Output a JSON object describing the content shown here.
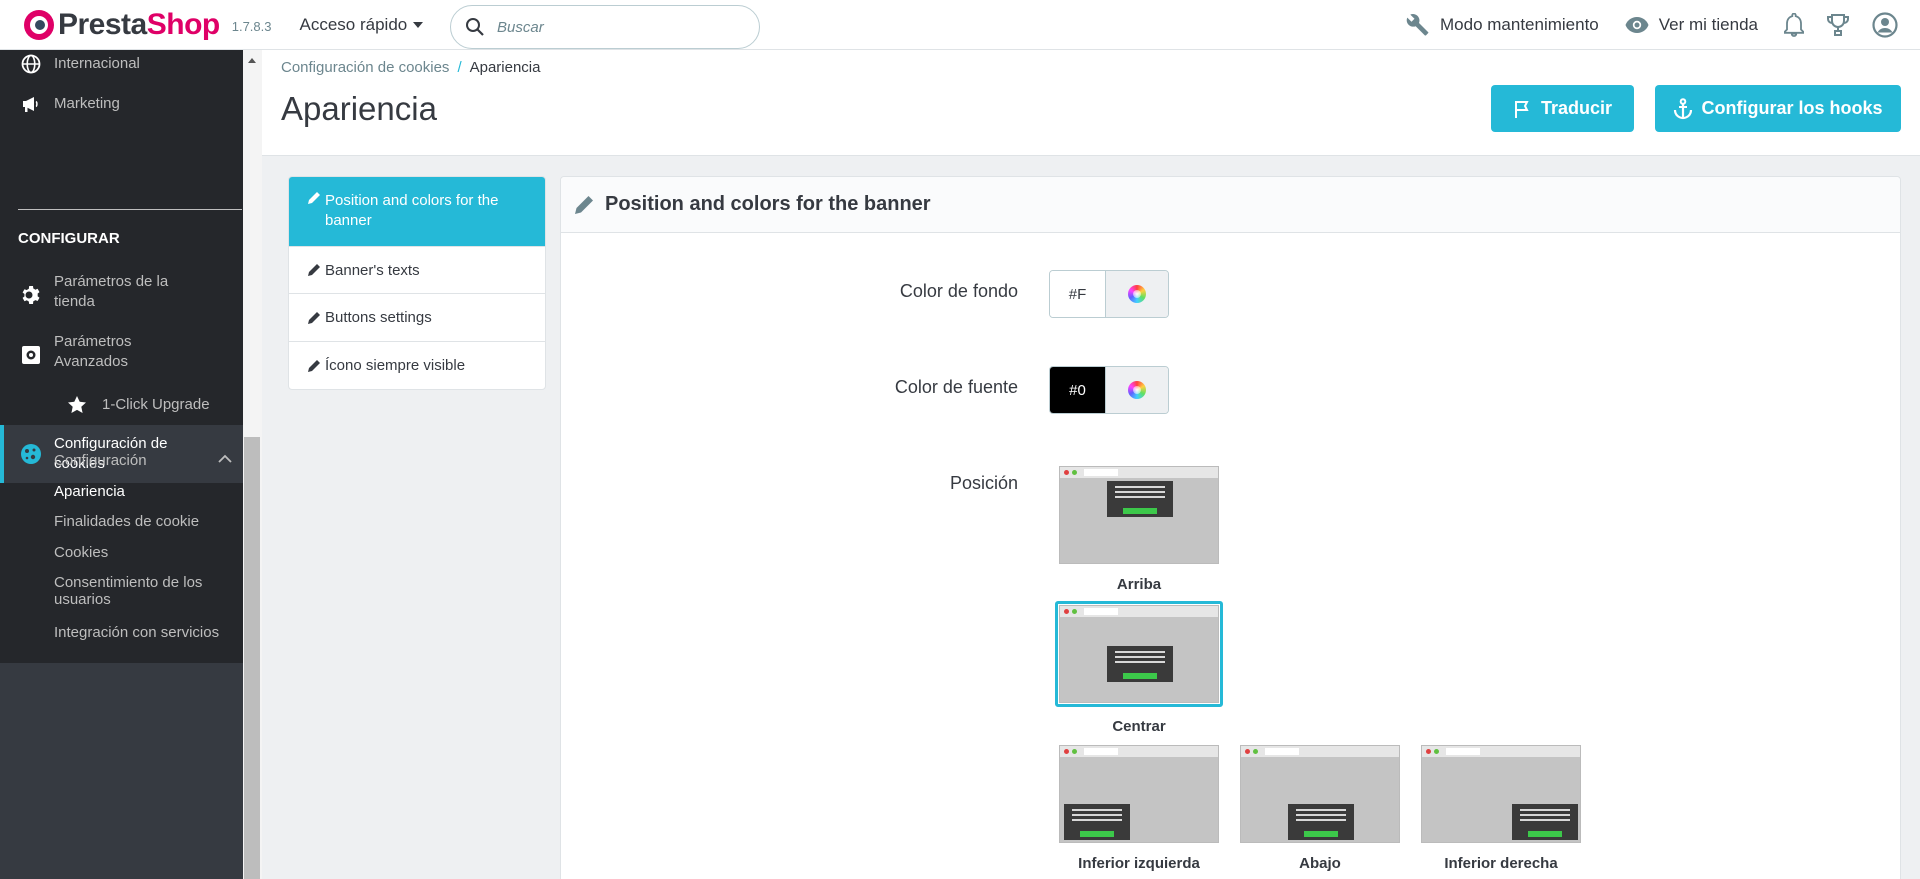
{
  "header": {
    "logo_text_1": "Presta",
    "logo_text_2": "Shop",
    "version": "1.7.8.3",
    "quick_access": "Acceso rápido",
    "search_placeholder": "Buscar",
    "maintenance": "Modo mantenimiento",
    "view_shop": "Ver mi tienda"
  },
  "sidebar": {
    "items_top": [
      {
        "label": "Internacional",
        "icon": "globe-icon"
      },
      {
        "label": "Marketing",
        "icon": "megaphone-icon"
      }
    ],
    "section": "CONFIGURAR",
    "store_params": [
      "Parámetros de la",
      "tienda"
    ],
    "advanced_params": [
      "Parámetros",
      "Avanzados"
    ],
    "one_click": "1-Click Upgrade",
    "cookies_config": [
      "Configuración de",
      "cookies"
    ],
    "submenu": [
      "Configuración",
      "Apariencia",
      "Finalidades de cookie",
      "Cookies",
      "Consentimiento de los",
      "usuarios",
      "Integración con servicios"
    ]
  },
  "breadcrumb": {
    "parent": "Configuración de cookies",
    "separator": "/",
    "current": "Apariencia"
  },
  "page": {
    "title": "Apariencia",
    "translate_button": "Traducir",
    "hooks_button": "Configurar los hooks"
  },
  "tabs": {
    "active_line1": "Position and colors for the",
    "active_line2": "banner",
    "texts": "Banner's texts",
    "buttons": "Buttons settings",
    "icon": "Ícono siempre visible"
  },
  "card": {
    "title": "Position and colors for the banner",
    "bg_label": "Color de fondo",
    "bg_value": "#F",
    "font_label": "Color de fuente",
    "font_value": "#0",
    "position_label": "Posición",
    "positions": [
      "Arriba",
      "Centrar",
      "Inferior izquierda",
      "Abajo",
      "Inferior derecha"
    ],
    "selected_position": "Centrar"
  },
  "colors": {
    "accent": "#25b9d7",
    "brand": "#df0067",
    "sidebar": "#25272b"
  }
}
